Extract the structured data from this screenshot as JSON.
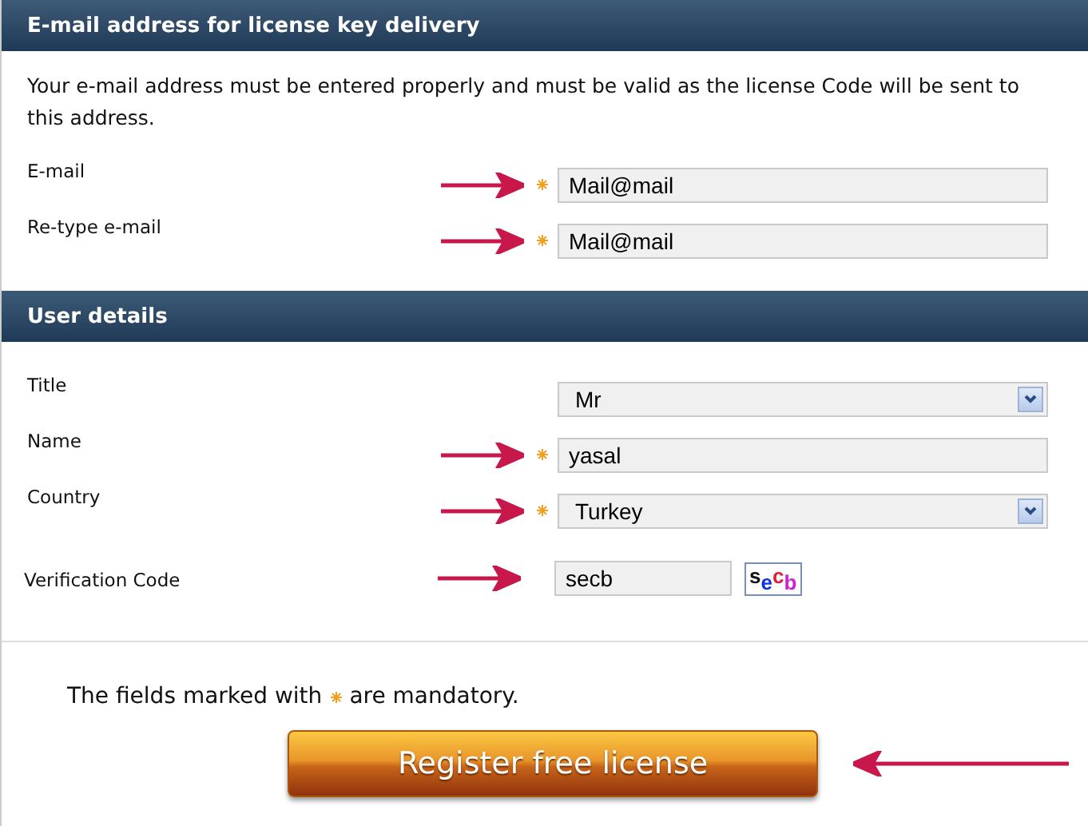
{
  "sections": [
    {
      "title": "E-mail address for license key delivery",
      "intro": "Your e-mail address must be entered properly and must be valid as the license Code will be sent to this address.",
      "fields": [
        {
          "kind": "text",
          "label": "E-mail",
          "value": "Mail@mail",
          "required": true,
          "arrow": true
        },
        {
          "kind": "text",
          "label": "Re-type e-mail",
          "value": "Mail@mail",
          "required": true,
          "arrow": true
        }
      ]
    },
    {
      "title": "User details",
      "fields": [
        {
          "kind": "select",
          "label": "Title",
          "value": "Mr",
          "required": false,
          "arrow": false
        },
        {
          "kind": "text",
          "label": "Name",
          "value": "yasal",
          "required": true,
          "arrow": true
        },
        {
          "kind": "select",
          "label": "Country",
          "value": "Turkey",
          "required": true,
          "arrow": true
        },
        {
          "kind": "captcha",
          "label": "Verification Code",
          "value": "secb",
          "captcha": "secb",
          "required": false,
          "arrow": true
        }
      ]
    }
  ],
  "footer": {
    "note_before": "The fields marked with",
    "note_after": "are mandatory.",
    "button": "Register free license",
    "button_arrow": true
  }
}
